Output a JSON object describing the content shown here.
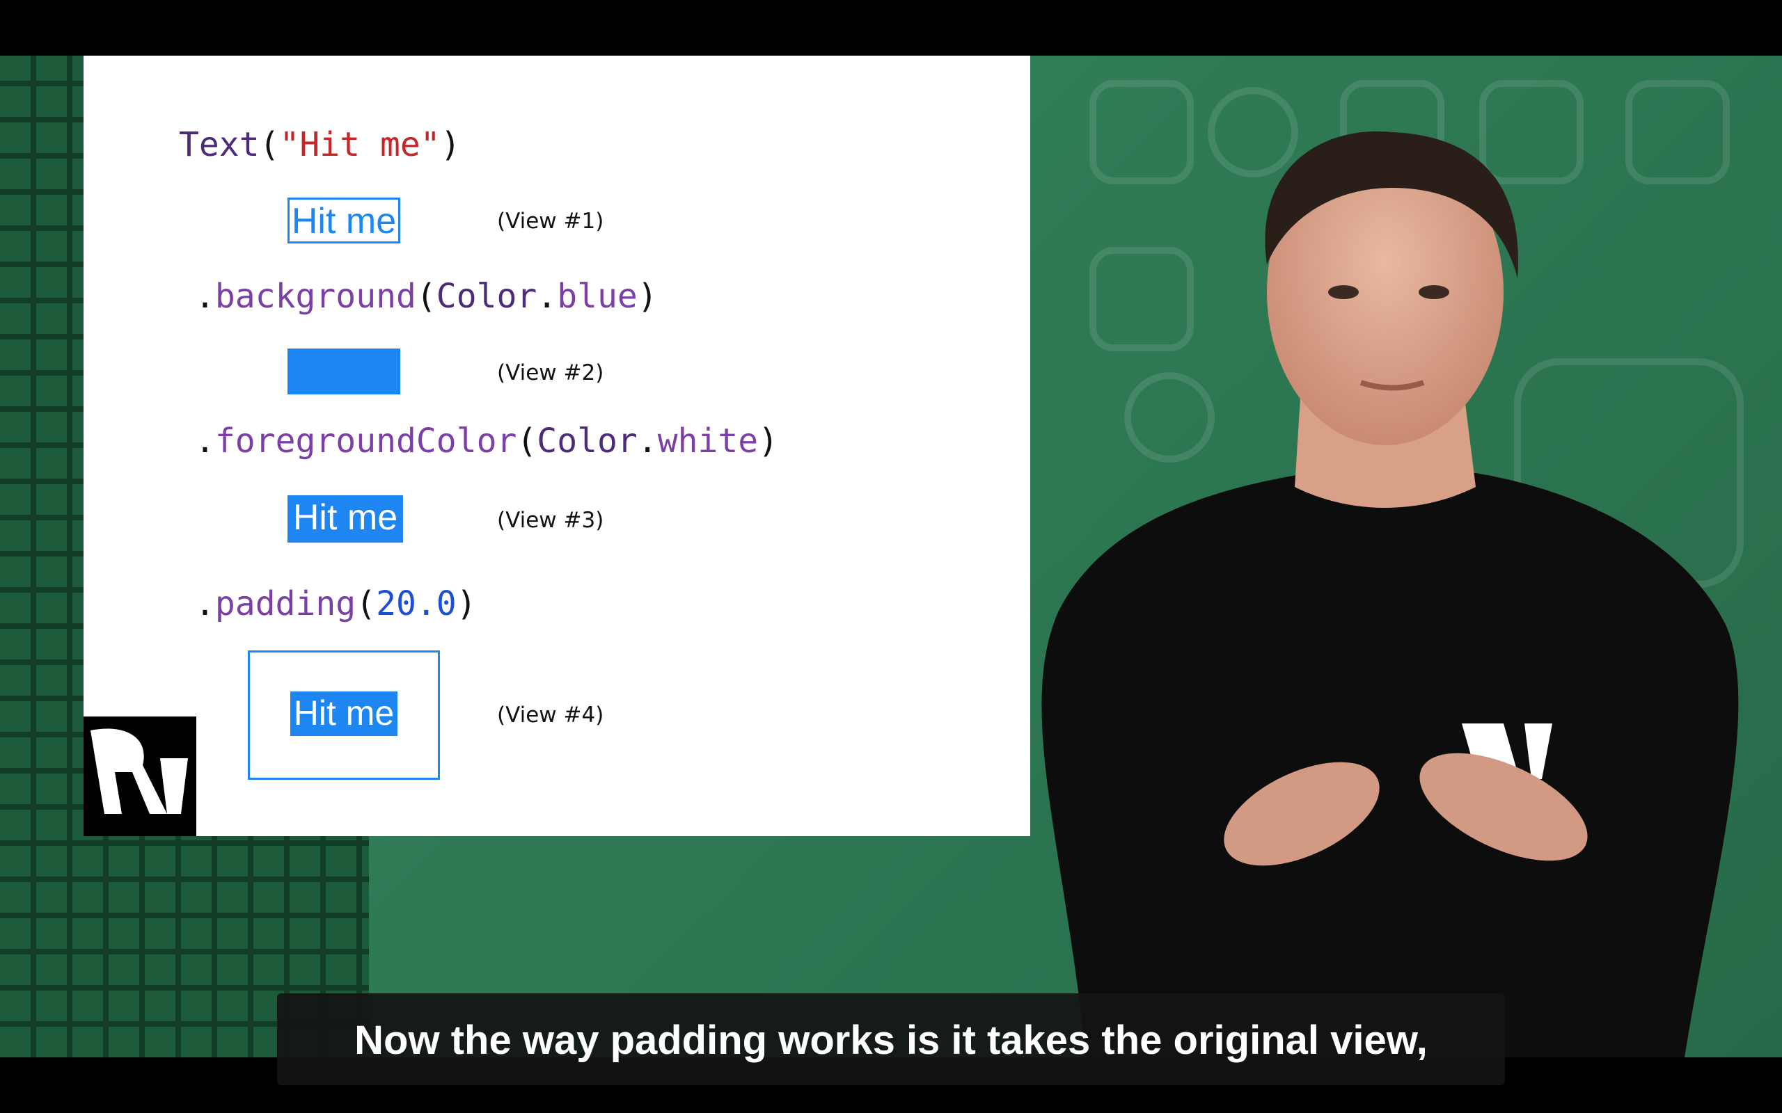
{
  "slide": {
    "code_text": {
      "kw": "Text",
      "open": "(",
      "str": "\"Hit me\"",
      "close": ")"
    },
    "code_background": {
      "dot": ".",
      "fn": "background",
      "open": "(",
      "arg_type": "Color",
      "dot2": ".",
      "arg_member": "blue",
      "close": ")"
    },
    "code_foreground": {
      "dot": ".",
      "fn": "foregroundColor",
      "open": "(",
      "arg_type": "Color",
      "dot2": ".",
      "arg_member": "white",
      "close": ")"
    },
    "code_padding": {
      "dot": ".",
      "fn": "padding",
      "open": "(",
      "num": "20.0",
      "close": ")"
    },
    "hit_label": "Hit me",
    "view1_label": "(View #1)",
    "view2_label": "(View #2)",
    "view3_label": "(View #3)",
    "view4_label": "(View #4)"
  },
  "colors": {
    "accent_blue": "#1e86f0",
    "background_green": "#2f7a55"
  },
  "subtitle": "Now the way padding works is it takes the original view,"
}
